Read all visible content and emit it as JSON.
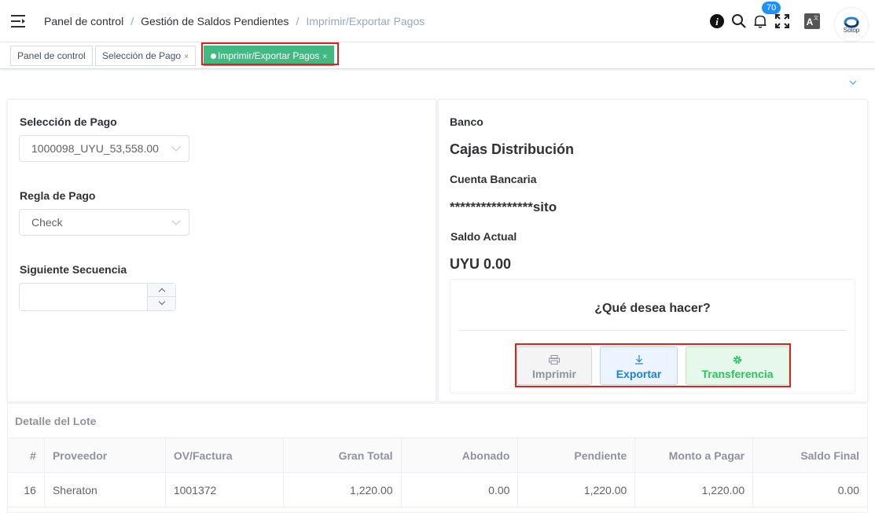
{
  "breadcrumb": [
    "Panel de control",
    "Gestión de Saldos Pendientes",
    "Imprimir/Exportar Pagos"
  ],
  "header": {
    "notification_count": "70",
    "avatar_text": "Solop",
    "icons": [
      "info-icon",
      "search-icon",
      "bell-icon",
      "fullscreen-icon",
      "translate-icon"
    ]
  },
  "tags": [
    {
      "label": "Panel de control",
      "closable": false,
      "active": false
    },
    {
      "label": "Selección de Pago",
      "closable": true,
      "active": false
    },
    {
      "label": "Imprimir/Exportar Pagos",
      "closable": true,
      "active": true
    }
  ],
  "form": {
    "payment_selection_label": "Selección de Pago",
    "payment_selection_value": "1000098_UYU_53,558.00",
    "payment_rule_label": "Regla de Pago",
    "payment_rule_value": "Check",
    "next_sequence_label": "Siguiente Secuencia",
    "next_sequence_value": ""
  },
  "bank": {
    "bank_label": "Banco",
    "bank_value": "Cajas Distribución",
    "account_label": "Cuenta Bancaria",
    "account_value": "****************sito",
    "balance_label": "Saldo Actual",
    "balance_value": "UYU 0.00"
  },
  "actions": {
    "question": "¿Qué desea hacer?",
    "print_label": "Imprimir",
    "export_label": "Exportar",
    "transfer_label": "Transferencia"
  },
  "batch": {
    "title": "Detalle del Lote",
    "columns": [
      "#",
      "Proveedor",
      "OV/Factura",
      "Gran Total",
      "Abonado",
      "Pendiente",
      "Monto a Pagar",
      "Saldo Final"
    ],
    "rows": [
      [
        "16",
        "Sheraton",
        "1001372",
        "1,220.00",
        "0.00",
        "1,220.00",
        "1,220.00",
        "0.00"
      ]
    ]
  },
  "colors": {
    "active_tag": "#42b983",
    "highlight": "#e0201f",
    "export": "#1e7fe0",
    "transfer": "#2cc35f",
    "badge": "#1e90ff"
  }
}
